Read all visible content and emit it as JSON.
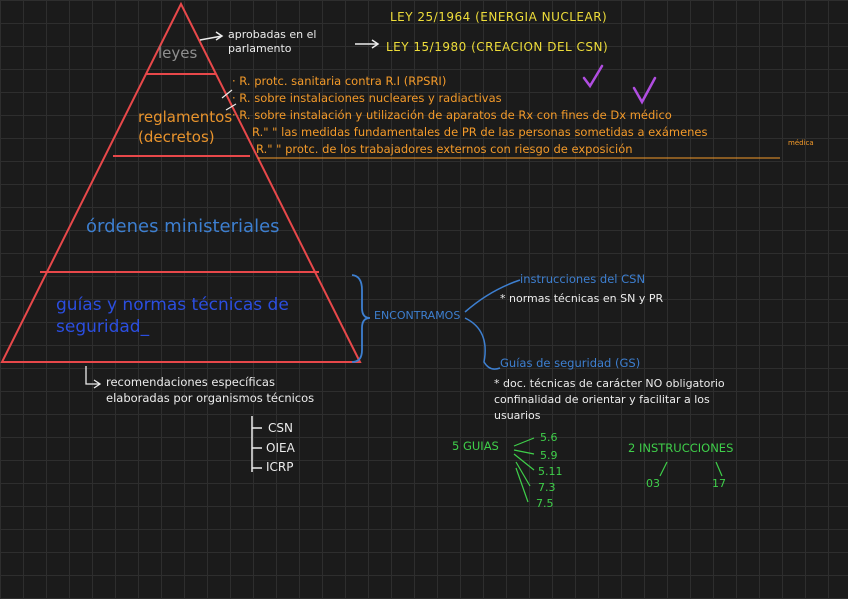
{
  "pyramid": {
    "levels": [
      {
        "label": "leyes"
      },
      {
        "label": "reglamentos\n(decretos)"
      },
      {
        "label": "órdenes ministeriales"
      },
      {
        "label": "guías y normas técnicas de\nseguridad_"
      }
    ]
  },
  "leyes_note": {
    "text": "aprobadas en el\nparlamento",
    "laws": [
      "LEY 25/1964 (ENERGIA NUCLEAR)",
      "LEY 15/1980 (CREACION DEL CSN)"
    ]
  },
  "reglamentos_list": [
    "· R. protc. sanitaria contra R.I (RPSRI)",
    "· R. sobre instalaciones nucleares y radiactivas",
    "· R. sobre instalación y utilización de aparatos de Rx con fines de Dx médico",
    "R.\" \" las medidas fundamentales de PR de las personas sometidas a exámenes",
    "R.\" \" protc. de los trabajadores externos con riesgo de exposición"
  ],
  "small_note": "médica",
  "checkmarks": [
    "check-icon",
    "check-icon"
  ],
  "encontramos": "ENCONTRAMOS",
  "instrucciones": {
    "title": "instrucciones del CSN",
    "desc": "* normas técnicas en SN y PR"
  },
  "guias_seguridad": {
    "title": "Guías de seguridad (GS)",
    "desc": "* doc. técnicas de carácter NO obligatorio\nconfinalidad de orientar y facilitar a los\nusuarios"
  },
  "recomendaciones": {
    "text": "recomendaciones específicas\nelaboradas por organismos técnicos",
    "orgs": [
      "CSN",
      "OIEA",
      "ICRP"
    ]
  },
  "guias_count": {
    "label": "5 GUIAS",
    "items": [
      "5.6",
      "5.9",
      "5.11",
      "7.3",
      "7.5"
    ]
  },
  "instrucciones_count": {
    "label": "2 INSTRUCCIONES",
    "items": [
      "03",
      "17"
    ]
  },
  "colors": {
    "pyramid": "#e8484a",
    "label_gray": "#8f8f8f",
    "note_white": "#ececec",
    "law_yellow": "#eedd3a",
    "list_orange": "#f39a2a",
    "check_purple": "#b04de0",
    "blue": "#3d7fd0",
    "green": "#3fcf4a"
  }
}
